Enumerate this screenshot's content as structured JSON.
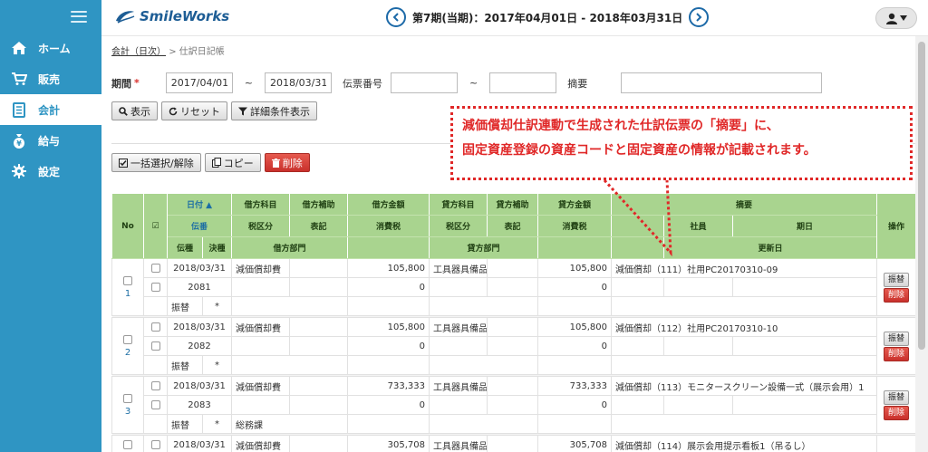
{
  "sidebar": {
    "items": [
      {
        "label": "ホーム",
        "icon": "home-icon"
      },
      {
        "label": "販売",
        "icon": "cart-icon"
      },
      {
        "label": "会計",
        "icon": "ledger-icon",
        "active": true
      },
      {
        "label": "給与",
        "icon": "money-bag-icon"
      },
      {
        "label": "設定",
        "icon": "gear-icon"
      }
    ]
  },
  "header": {
    "logo_text": "SmileWorks",
    "period": "第7期(当期)：2017年04月01日 - 2018年03月31日"
  },
  "breadcrumb": {
    "parent": "会計（日次）",
    "separator": ">",
    "current": "仕訳日記帳"
  },
  "filters": {
    "period_label": "期間",
    "required_mark": "*",
    "date_from": "2017/04/01",
    "tilde": "~",
    "date_to": "2018/03/31",
    "slip_no_label": "伝票番号",
    "slip_from": "",
    "slip_to": "",
    "memo_label": "摘要",
    "memo": ""
  },
  "buttons": {
    "show": "表示",
    "reset": "リセット",
    "detail": "詳細条件表示",
    "select_all": "一括選択/解除",
    "copy": "コピー",
    "delete": "削除"
  },
  "callout": {
    "line1": "減価償却仕訳連動で生成された仕訳伝票の「摘要」に、",
    "line2": "固定資産登録の資産コードと固定資産の情報が記載されます。"
  },
  "table": {
    "h_no": "No",
    "h_check": "☑",
    "h_date": "日付 ▲",
    "h_slip": "伝番",
    "h_type": "伝種",
    "h_kind": "決種",
    "h_dr_acc": "借方科目",
    "h_dr_sub": "借方補助",
    "h_dr_amt": "借方金額",
    "h_cr_acc": "貸方科目",
    "h_cr_sub": "貸方補助",
    "h_cr_amt": "貸方金額",
    "h_memo": "摘要",
    "h_tax": "税区分",
    "h_disp": "表記",
    "h_ctax": "消費税",
    "h_staff": "社員",
    "h_due": "期日",
    "h_dr_dept": "借方部門",
    "h_cr_dept": "貸方部門",
    "h_updated": "更新日",
    "h_ops": "操作",
    "rows": [
      {
        "no": "1",
        "date": "2018/03/31",
        "slip": "2081",
        "type": "振替",
        "kind": "*",
        "dr_acc": "減価償却費",
        "dr_amt": "105,800",
        "dr_tax": "0",
        "cr_acc": "工具器具備品",
        "cr_amt": "105,800",
        "cr_tax": "0",
        "memo": "減価償却（111）社用PC20170310-09",
        "dr_dept": ""
      },
      {
        "no": "2",
        "date": "2018/03/31",
        "slip": "2082",
        "type": "振替",
        "kind": "*",
        "dr_acc": "減価償却費",
        "dr_amt": "105,800",
        "dr_tax": "0",
        "cr_acc": "工具器具備品",
        "cr_amt": "105,800",
        "cr_tax": "0",
        "memo": "減価償却（112）社用PC20170310-10",
        "dr_dept": ""
      },
      {
        "no": "3",
        "date": "2018/03/31",
        "slip": "2083",
        "type": "振替",
        "kind": "*",
        "dr_acc": "減価償却費",
        "dr_amt": "733,333",
        "dr_tax": "0",
        "cr_acc": "工具器具備品",
        "cr_amt": "733,333",
        "cr_tax": "0",
        "memo": "減価償却（113）モニタースクリーン設備一式（展示会用）1",
        "dr_dept": "総務課"
      },
      {
        "date": "2018/03/31",
        "dr_acc": "減価償却費",
        "dr_amt": "305,708",
        "cr_acc": "工具器具備品",
        "cr_amt": "305,708",
        "memo": "減価償却（114）展示会用提示看板1（吊るし）"
      }
    ],
    "op_transfer": "振替",
    "op_delete": "削除"
  },
  "colors": {
    "sidebar": "#2f95c3",
    "table_header": "#a9d48f",
    "callout": "#e02828",
    "delete": "#c9302c"
  }
}
